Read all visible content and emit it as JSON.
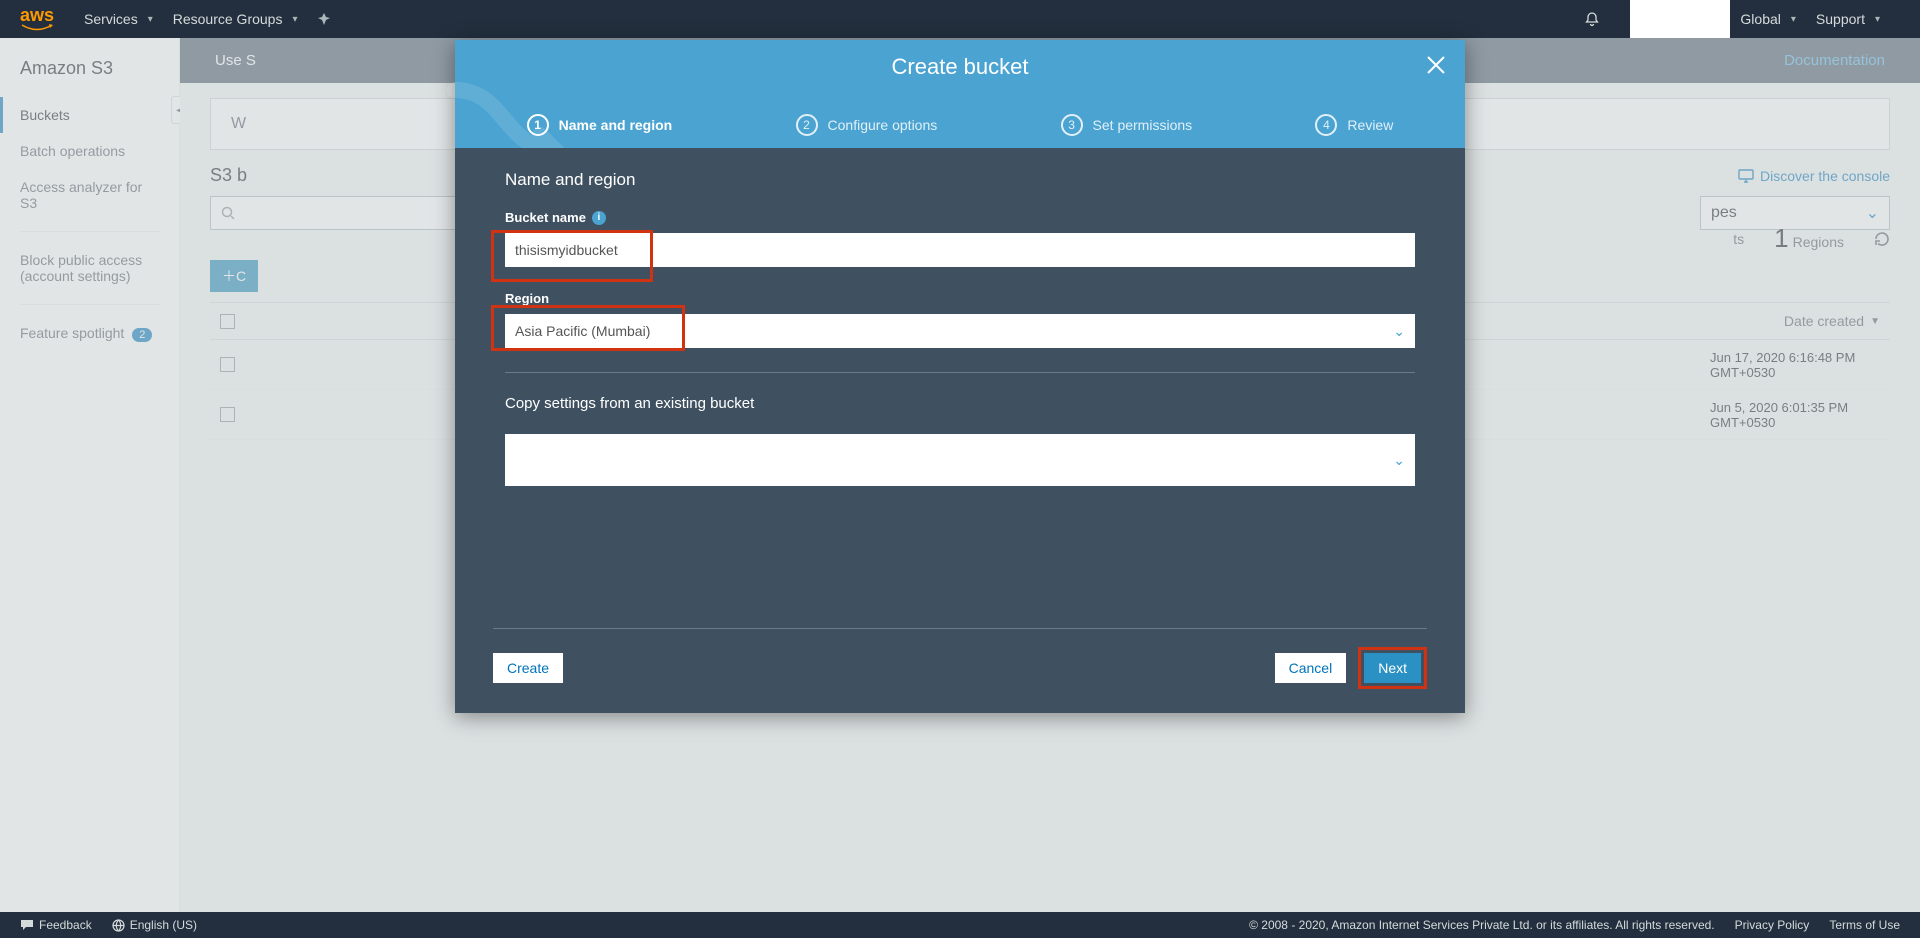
{
  "topnav": {
    "logo": "aws",
    "services": "Services",
    "resource_groups": "Resource Groups",
    "global": "Global",
    "support": "Support"
  },
  "sidebar": {
    "title": "Amazon S3",
    "items": [
      "Buckets",
      "Batch operations",
      "Access analyzer for S3"
    ],
    "block_public": "Block public access (account settings)",
    "feature": "Feature spotlight",
    "feature_badge": "2"
  },
  "bluebar": {
    "use": "Use S",
    "doc": "Documentation"
  },
  "page": {
    "card1_w": "W",
    "s3b": "S3 b",
    "discover": "Discover the console",
    "pes": "pes",
    "ts": "ts",
    "regions_count": "1",
    "regions_label": "Regions",
    "date_created": "Date created",
    "row1": "Jun 17, 2020 6:16:48 PM GMT+0530",
    "row2": "Jun 5, 2020 6:01:35 PM GMT+0530"
  },
  "modal": {
    "title": "Create bucket",
    "steps": [
      "Name and region",
      "Configure options",
      "Set permissions",
      "Review"
    ],
    "section_title": "Name and region",
    "bucket_label": "Bucket name",
    "bucket_value": "thisismyidbucket",
    "region_label": "Region",
    "region_value": "Asia Pacific (Mumbai)",
    "copy_label": "Copy settings from an existing bucket",
    "create": "Create",
    "cancel": "Cancel",
    "next": "Next"
  },
  "footer": {
    "feedback": "Feedback",
    "language": "English (US)",
    "copyright": "© 2008 - 2020, Amazon Internet Services Private Ltd. or its affiliates. All rights reserved.",
    "privacy": "Privacy Policy",
    "terms": "Terms of Use"
  }
}
